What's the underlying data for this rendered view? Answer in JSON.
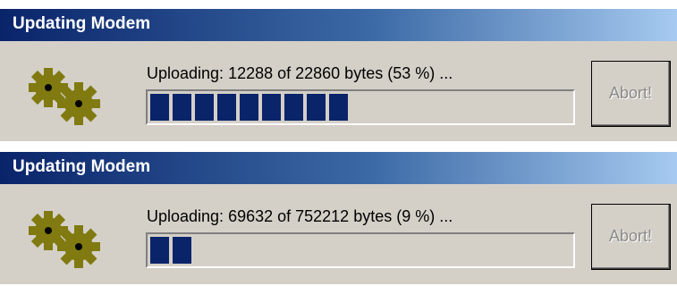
{
  "dialogs": [
    {
      "title": "Updating Modem",
      "status": "Uploading: 12288 of 22860 bytes (53 %) ...",
      "progress_percent": 53,
      "filled_blocks": 9,
      "abort_label": "Abort!",
      "abort_enabled": false
    },
    {
      "title": "Updating Modem",
      "status": "Uploading: 69632 of 752212 bytes (9 %) ...",
      "progress_percent": 9,
      "filled_blocks": 2,
      "abort_label": "Abort!",
      "abort_enabled": false
    }
  ],
  "icons": {
    "app_icon": "gears-icon"
  },
  "colors": {
    "title_gradient_start": "#0a246a",
    "title_gradient_end": "#a6caf0",
    "progress_fill": "#0a246a",
    "face": "#d4d0c8",
    "gear": "#807a10"
  }
}
